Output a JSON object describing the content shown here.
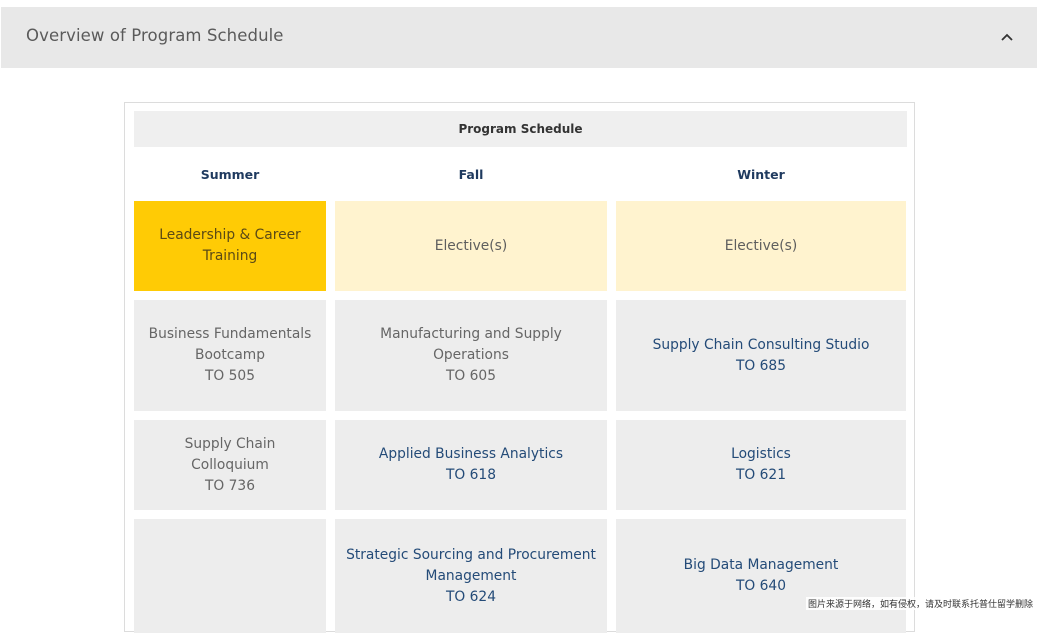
{
  "accordion": {
    "title": "Overview of Program Schedule",
    "icon": "chevron-up-icon"
  },
  "table": {
    "title": "Program Schedule",
    "columns": [
      "Summer",
      "Fall",
      "Winter"
    ],
    "rows": [
      [
        {
          "lines": [
            "Leadership & Career",
            "Training"
          ],
          "style": "gold"
        },
        {
          "lines": [
            "Elective(s)"
          ],
          "style": "cream"
        },
        {
          "lines": [
            "Elective(s)"
          ],
          "style": "cream"
        }
      ],
      [
        {
          "lines": [
            "Business Fundamentals",
            "Bootcamp",
            "TO 505"
          ],
          "style": "grey"
        },
        {
          "lines": [
            "Manufacturing and Supply",
            "Operations",
            "TO 605"
          ],
          "style": "grey"
        },
        {
          "lines": [
            "Supply Chain Consulting Studio",
            "TO 685"
          ],
          "style": "grey-link"
        }
      ],
      [
        {
          "lines": [
            "Supply Chain Colloquium",
            "TO 736"
          ],
          "style": "grey"
        },
        {
          "lines": [
            "Applied Business Analytics",
            "TO 618"
          ],
          "style": "grey-link"
        },
        {
          "lines": [
            "Logistics",
            "TO 621"
          ],
          "style": "grey-link"
        }
      ],
      [
        {
          "lines": [],
          "style": "grey"
        },
        {
          "lines": [
            "Strategic Sourcing and Procurement",
            "Management",
            "TO 624"
          ],
          "style": "grey-link"
        },
        {
          "lines": [
            "Big Data Management",
            "TO 640"
          ],
          "style": "grey-link"
        }
      ]
    ]
  },
  "watermark": "图片来源于网络，如有侵权，请及时联系托普仕留学删除",
  "colors": {
    "gold": "#ffcb05",
    "cream": "#fff3cf",
    "grey": "#ededed",
    "link": "#244b78"
  }
}
